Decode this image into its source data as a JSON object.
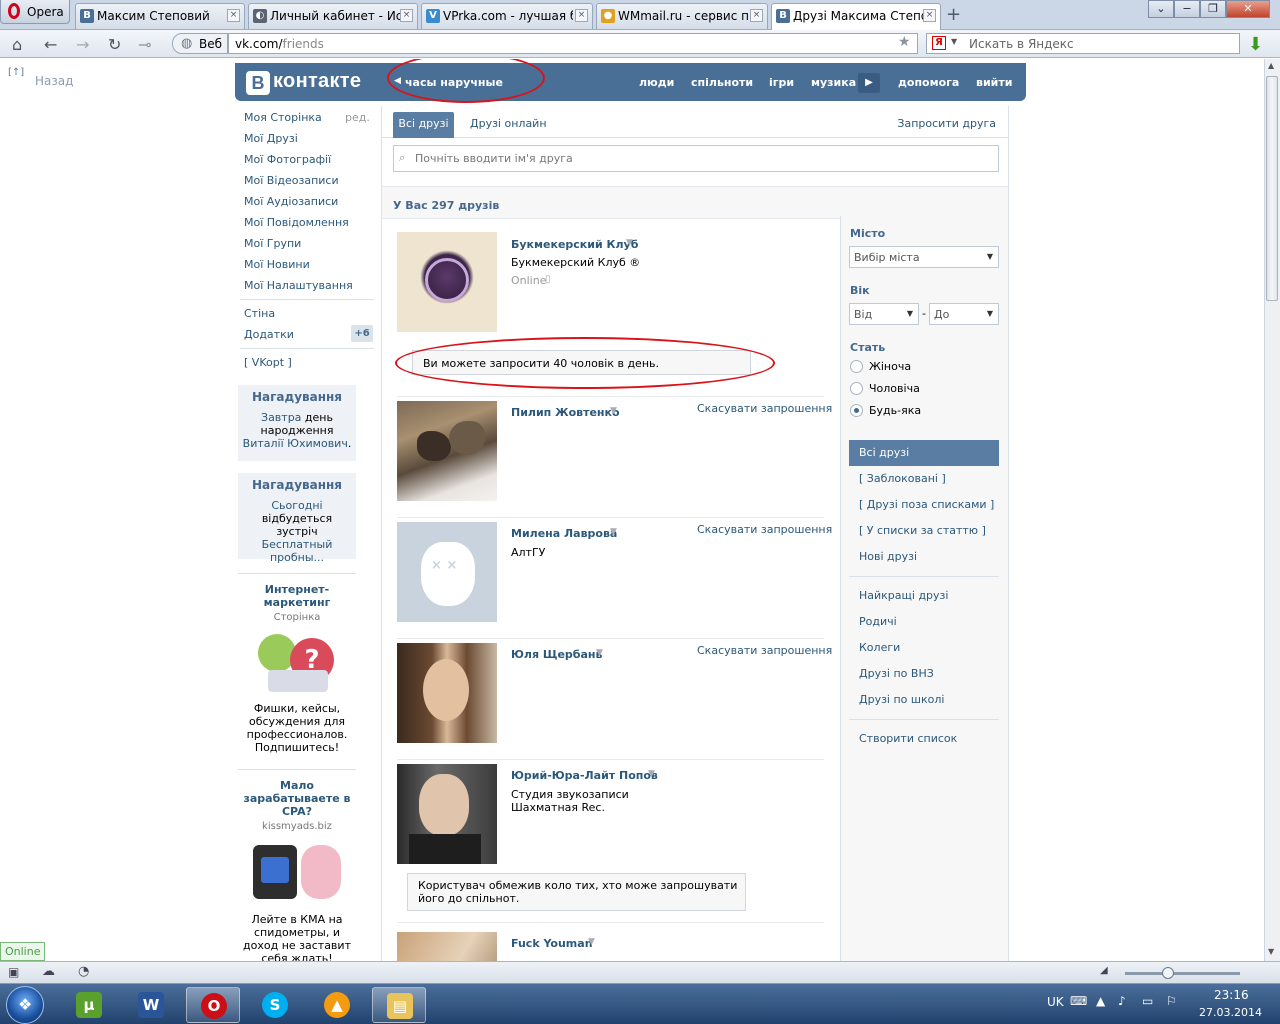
{
  "browser": {
    "opera_label": "Opera",
    "tabs": [
      {
        "title": "Максим Степовий",
        "icon": "vk-icon",
        "color": "#4a6f96"
      },
      {
        "title": "Личный кабинет - Ис...",
        "icon": "disk-icon",
        "color": "#5b6470"
      },
      {
        "title": "VPrka.com - лучшая б...",
        "icon": "vprka-icon",
        "color": "#3a8ad0"
      },
      {
        "title": "WMmail.ru - сервис п...",
        "icon": "wmmail-icon",
        "color": "#e0a020"
      },
      {
        "title": "Друзі Максима Степо...",
        "icon": "vk-icon",
        "color": "#4a6f96"
      }
    ],
    "web_label": "Веб",
    "url_host": "vk.com/",
    "url_path": "friends",
    "search_placeholder": "Искать в Яндекс",
    "yandex_letter": "Я"
  },
  "page": {
    "back_label": "Назад",
    "back_arrow": "[↑]",
    "logo_b": "В",
    "logo_text": "контакте",
    "status_text": "часы наручные",
    "nav": [
      "люди",
      "спільноти",
      "ігри",
      "музика",
      "допомога",
      "вийти"
    ]
  },
  "left_menu": {
    "items": [
      "Моя Сторінка",
      "Мої Друзі",
      "Мої Фотографії",
      "Мої Відеозаписи",
      "Мої Аудіозаписи",
      "Мої Повідомлення",
      "Мої Групи",
      "Мої Новини",
      "Мої Налаштування"
    ],
    "edit_label": "ред.",
    "extra": [
      "Стіна",
      "Додатки"
    ],
    "apps_badge": "+6",
    "vkopt": "[ VKopt ]",
    "reminder1": {
      "title": "Нагадування",
      "link1": "Завтра",
      "text1": " день народження ",
      "link2": "Виталії Юхимович",
      "tail": "."
    },
    "reminder2": {
      "title": "Нагадування",
      "link1": "Сьогодні",
      "text1": " відбудеться зустріч ",
      "link2": "Бесплатный пробны..."
    },
    "ad1": {
      "title": "Интернет-маркетинг",
      "sub": "Сторінка",
      "text": "Фишки, кейсы, обсуждения для профессионалов. Подпишитесь!"
    },
    "ad2": {
      "title": "Мало зарабатываете в CPA?",
      "sub": "kissmyads.biz",
      "text": "Лейте в КМА на спидометры, и доход не заставит себя ждать!"
    }
  },
  "main": {
    "tab_all": "Всі друзі",
    "tab_online": "Друзі онлайн",
    "invite_friend": "Запросити друга",
    "search_placeholder": "Почніть вводити ім'я друга",
    "friends_count": "У Вас 297 друзів",
    "invite_notice": "Ви можете запросити 40 чоловік в день.",
    "restricted_notice": "Користувач обмежив коло тих, хто може запрошувати його до спільнот.",
    "friends": [
      {
        "name": "Букмекерский Клуб",
        "sub": "Букмекерский Клуб ®",
        "online": "Online",
        "action": ""
      },
      {
        "name": "Пилип Жовтенко",
        "sub": "",
        "online": "",
        "action": "Скасувати запрошення"
      },
      {
        "name": "Милена Лаврова",
        "sub": "АлтГУ",
        "online": "",
        "action": "Скасувати запрошення"
      },
      {
        "name": "Юля Щербань",
        "sub": "",
        "online": "",
        "action": "Скасувати запрошення"
      },
      {
        "name": "Юрий-Юра-Лайт Попов",
        "sub": "Студия звукозаписи Шахматная Rec.",
        "online": "",
        "action": ""
      },
      {
        "name": "Fuck Youman",
        "sub": "",
        "online": "",
        "action": ""
      }
    ]
  },
  "filters": {
    "city_label": "Місто",
    "city_value": "Вибір міста",
    "age_label": "Вік",
    "age_from": "Від",
    "age_dash": "-",
    "age_to": "До",
    "sex_label": "Стать",
    "sex_options": [
      "Жіноча",
      "Чоловіча",
      "Будь-яка"
    ],
    "sex_selected": "Будь-яка",
    "lists_selected": "Всі друзі",
    "lists": [
      "[ Заблоковані ]",
      "[ Друзі поза списками ]",
      "[ У списки за статтю ]",
      "Нові друзі"
    ],
    "groups": [
      "Найкращі друзі",
      "Родичі",
      "Колеги",
      "Друзі по ВНЗ",
      "Друзі по школі"
    ],
    "create_list": "Створити список"
  },
  "statusbar": {
    "online_label": "Online"
  },
  "taskbar": {
    "apps": [
      "utorrent-icon",
      "word-icon",
      "opera-icon",
      "skype-icon",
      "aimp-icon",
      "explorer-icon"
    ],
    "lang": "UK",
    "time": "23:16",
    "date": "27.03.2014"
  },
  "colors": {
    "vk_blue": "#4a6f96",
    "link": "#2b587a",
    "annotation_red": "#d8141a"
  }
}
